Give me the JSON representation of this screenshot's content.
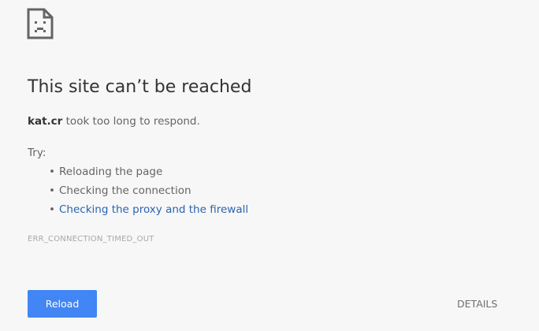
{
  "error": {
    "icon": "sad-page-icon",
    "heading": "This site can’t be reached",
    "host": "kat.cr",
    "summary_suffix": " took too long to respond.",
    "try_label": "Try:",
    "suggestions": [
      {
        "label": "Reloading the page",
        "is_link": false
      },
      {
        "label": "Checking the connection",
        "is_link": false
      },
      {
        "label": "Checking the proxy and the firewall",
        "is_link": true
      }
    ],
    "code": "ERR_CONNECTION_TIMED_OUT"
  },
  "buttons": {
    "reload_label": "Reload",
    "details_label": "DETAILS"
  },
  "colors": {
    "background": "#f7f7f7",
    "primary_button": "#4285f4",
    "link": "#2a64b0",
    "heading": "#333333",
    "body_text": "#646464",
    "error_code": "#a8a8a8"
  }
}
